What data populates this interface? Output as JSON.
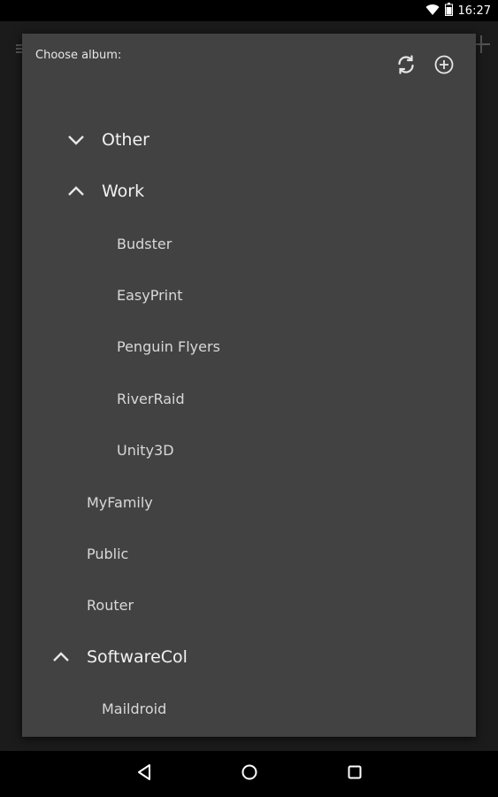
{
  "status_bar": {
    "time": "16:27",
    "icons": [
      "wifi-icon",
      "battery-icon"
    ]
  },
  "dialog": {
    "title": "Choose album:",
    "actions": [
      {
        "name": "refresh-icon",
        "label": ""
      },
      {
        "name": "add-circle-icon",
        "label": ""
      }
    ]
  },
  "tree": {
    "items": [
      {
        "label": "Other",
        "type": "group",
        "expanded": false
      },
      {
        "label": "Work",
        "type": "group",
        "expanded": true
      },
      {
        "label": "Budster",
        "type": "leaf"
      },
      {
        "label": "EasyPrint",
        "type": "leaf"
      },
      {
        "label": "Penguin Flyers",
        "type": "leaf"
      },
      {
        "label": "RiverRaid",
        "type": "leaf"
      },
      {
        "label": "Unity3D",
        "type": "leaf"
      },
      {
        "label": "MyFamily",
        "type": "leaf"
      },
      {
        "label": "Public",
        "type": "leaf"
      },
      {
        "label": "Router",
        "type": "leaf"
      },
      {
        "label": "SoftwareCol",
        "type": "group",
        "expanded": true
      },
      {
        "label": "Maildroid",
        "type": "leaf"
      }
    ]
  },
  "nav_bar": {
    "buttons": [
      "back-icon",
      "home-icon",
      "recents-icon"
    ]
  }
}
